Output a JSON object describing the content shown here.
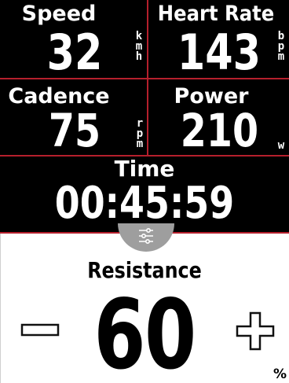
{
  "metrics": {
    "speed": {
      "label": "Speed",
      "value": "32",
      "unit": "kmh"
    },
    "heart_rate": {
      "label": "Heart Rate",
      "value": "143",
      "unit": "bpm"
    },
    "cadence": {
      "label": "Cadence",
      "value": "75",
      "unit": "rpm"
    },
    "power": {
      "label": "Power",
      "value": "210",
      "unit": "w"
    }
  },
  "time": {
    "label": "Time",
    "value": "00:45:59"
  },
  "resistance": {
    "label": "Resistance",
    "value": "60",
    "unit": "%"
  },
  "icons": {
    "settings": "sliders-icon",
    "decrease": "minus-icon",
    "increase": "plus-icon"
  },
  "colors": {
    "dashboard_bg": "#000000",
    "divider": "#b51f2c",
    "text_light": "#ffffff",
    "settings_tab": "#9e9e9e"
  }
}
